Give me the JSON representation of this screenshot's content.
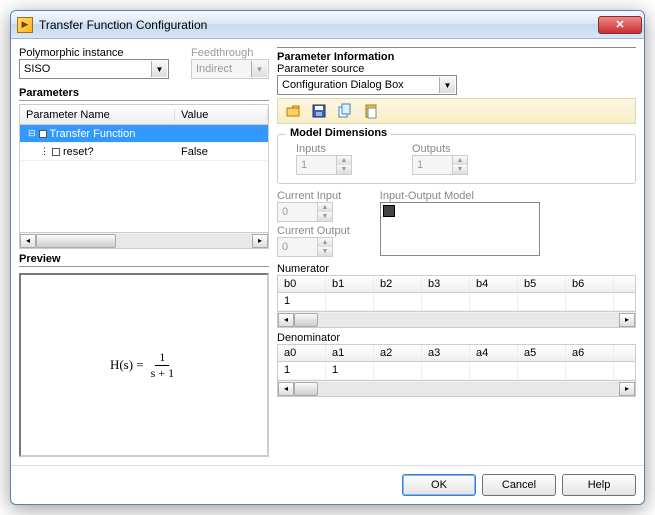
{
  "window": {
    "title": "Transfer Function Configuration"
  },
  "left": {
    "poly_label": "Polymorphic instance",
    "poly_value": "SISO",
    "feed_label": "Feedthrough",
    "feed_value": "Indirect",
    "params_header": "Parameters",
    "col_name": "Parameter Name",
    "col_value": "Value",
    "rows": [
      {
        "name": "Transfer Function",
        "value": "",
        "selected": true
      },
      {
        "name": "reset?",
        "value": "False",
        "selected": false
      }
    ],
    "preview_header": "Preview",
    "formula_lhs": "H(s) =",
    "formula_num": "1",
    "formula_den": "s + 1"
  },
  "right": {
    "title": "Parameter Information",
    "source_label": "Parameter source",
    "source_value": "Configuration Dialog Box",
    "model_dim": {
      "title": "Model Dimensions",
      "inputs_label": "Inputs",
      "inputs_value": "1",
      "outputs_label": "Outputs",
      "outputs_value": "1"
    },
    "cur_input_label": "Current Input",
    "cur_input_value": "0",
    "cur_output_label": "Current Output",
    "cur_output_value": "0",
    "io_model_label": "Input-Output Model",
    "numerator_label": "Numerator",
    "num_headers": [
      "b0",
      "b1",
      "b2",
      "b3",
      "b4",
      "b5",
      "b6"
    ],
    "num_values": [
      "1",
      "",
      "",
      "",
      "",
      "",
      ""
    ],
    "denominator_label": "Denominator",
    "den_headers": [
      "a0",
      "a1",
      "a2",
      "a3",
      "a4",
      "a5",
      "a6"
    ],
    "den_values": [
      "1",
      "1",
      "",
      "",
      "",
      "",
      ""
    ]
  },
  "buttons": {
    "ok": "OK",
    "cancel": "Cancel",
    "help": "Help"
  }
}
